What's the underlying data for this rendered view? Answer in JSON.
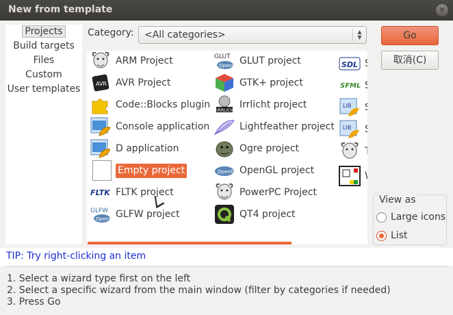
{
  "window": {
    "title": "New from template"
  },
  "sidebar": {
    "items": [
      "Projects",
      "Build targets",
      "Files",
      "Custom",
      "User templates"
    ]
  },
  "category": {
    "label": "Category:",
    "value": "<All categories>"
  },
  "projects": [
    {
      "label": "ARM Project",
      "icon": "gnu-icon"
    },
    {
      "label": "AVR Project",
      "icon": "avr-chip-icon"
    },
    {
      "label": "Code::Blocks plugin",
      "icon": "puzzle-piece-icon"
    },
    {
      "label": "Console application",
      "icon": "shell-window-icon"
    },
    {
      "label": "D application",
      "icon": "shell-window-icon"
    },
    {
      "label": "Empty project",
      "icon": "blank-page-icon"
    },
    {
      "label": "FLTK project",
      "icon": "fltk-icon"
    },
    {
      "label": "GLFW project",
      "icon": "glfw-opengl-icon"
    },
    {
      "label": "GLUT project",
      "icon": "glut-opengl-icon"
    },
    {
      "label": "GTK+ project",
      "icon": "gtk-cube-icon"
    },
    {
      "label": "Irrlicht project",
      "icon": "irrlicht-icon"
    },
    {
      "label": "Lightfeather project",
      "icon": "feather-icon"
    },
    {
      "label": "Ogre project",
      "icon": "ogre-icon"
    },
    {
      "label": "OpenGL project",
      "icon": "opengl-icon"
    },
    {
      "label": "PowerPC Project",
      "icon": "gnu-icon"
    },
    {
      "label": "QT4 project",
      "icon": "qt-icon"
    },
    {
      "label": "S",
      "icon": "sdl-icon"
    },
    {
      "label": "S",
      "icon": "sfml-icon"
    },
    {
      "label": "S",
      "icon": "library-icon"
    },
    {
      "label": "S",
      "icon": "library-icon"
    },
    {
      "label": "T",
      "icon": "gnu-icon"
    },
    {
      "label": "W",
      "icon": "window-layout-icon"
    }
  ],
  "buttons": {
    "go": "Go",
    "cancel": "取消(C)"
  },
  "view_as": {
    "legend": "View as",
    "large_icons": "Large icons",
    "list": "List",
    "selected": "List"
  },
  "tip": "TIP: Try right-clicking an item",
  "instructions": [
    "1. Select a wizard type first on the left",
    "2. Select a specific wizard from the main window (filter by categories if needed)",
    "3. Press Go"
  ],
  "colors": {
    "accent": "#e9683a",
    "tip_text": "#1a2fd0",
    "titlebar": "#3b3a36"
  }
}
